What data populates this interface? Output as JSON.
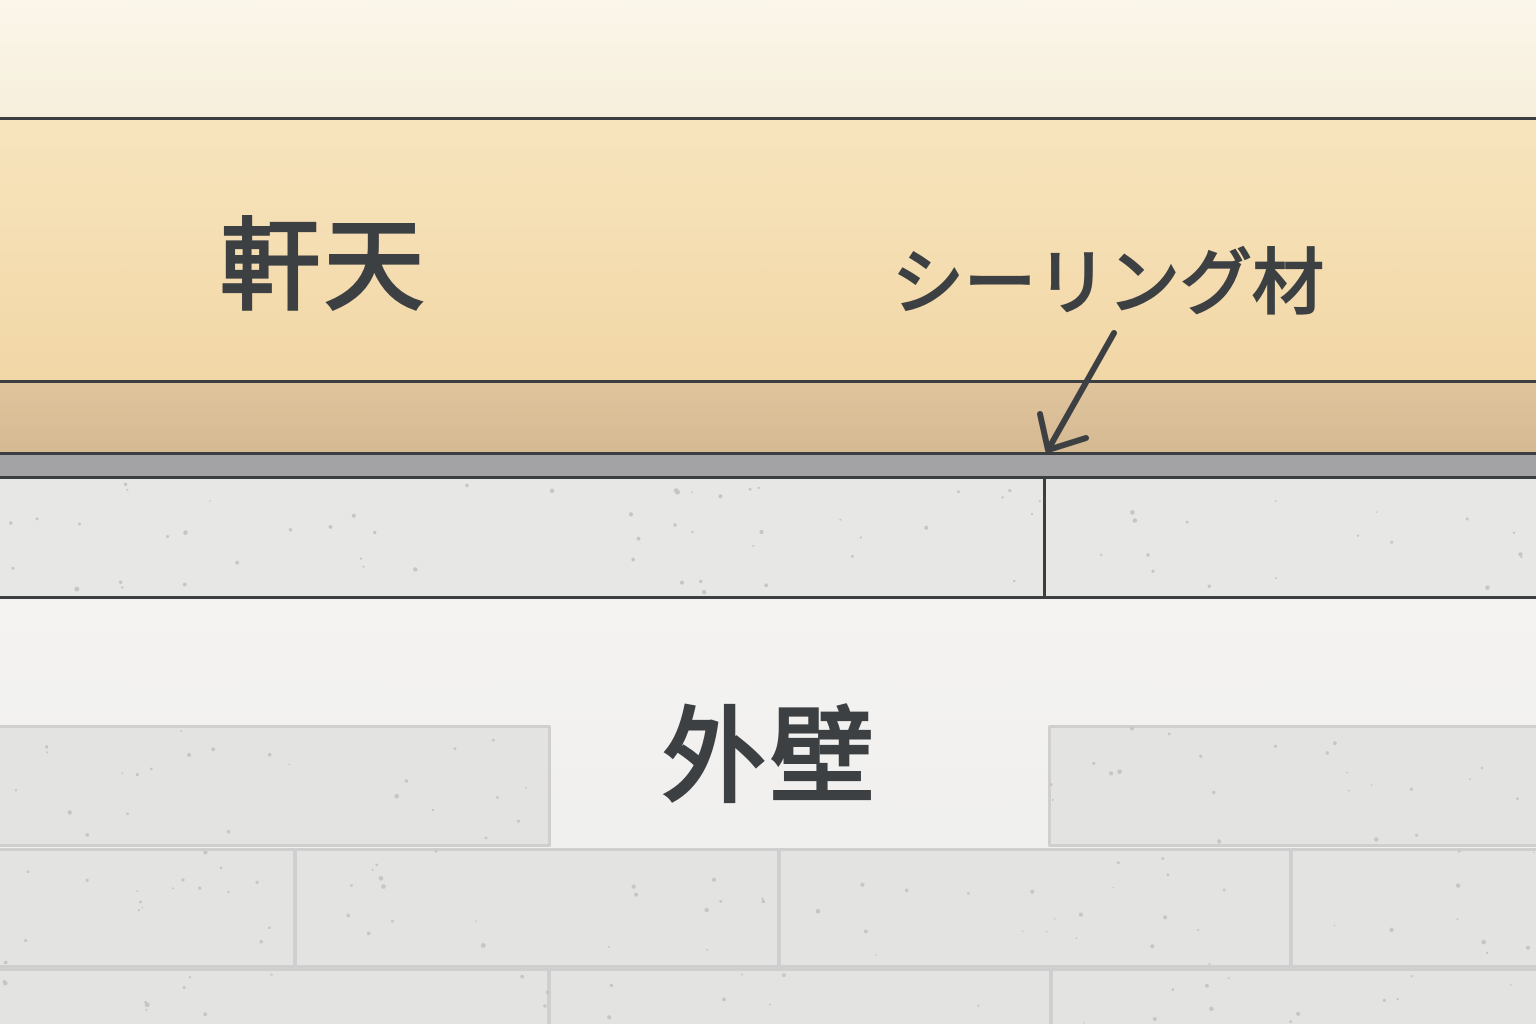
{
  "labels": {
    "soffit": "軒天",
    "sealant": "シーリング材",
    "exterior_wall": "外壁"
  },
  "colors": {
    "soffit": "#f2d7a6",
    "fascia": "#d5b993",
    "sealant": "#a3a3a6",
    "wall": "#e7e7e6",
    "outline": "#3b3f42",
    "text": "#3d4043"
  },
  "icons": {
    "pointer": "arrow-icon"
  }
}
